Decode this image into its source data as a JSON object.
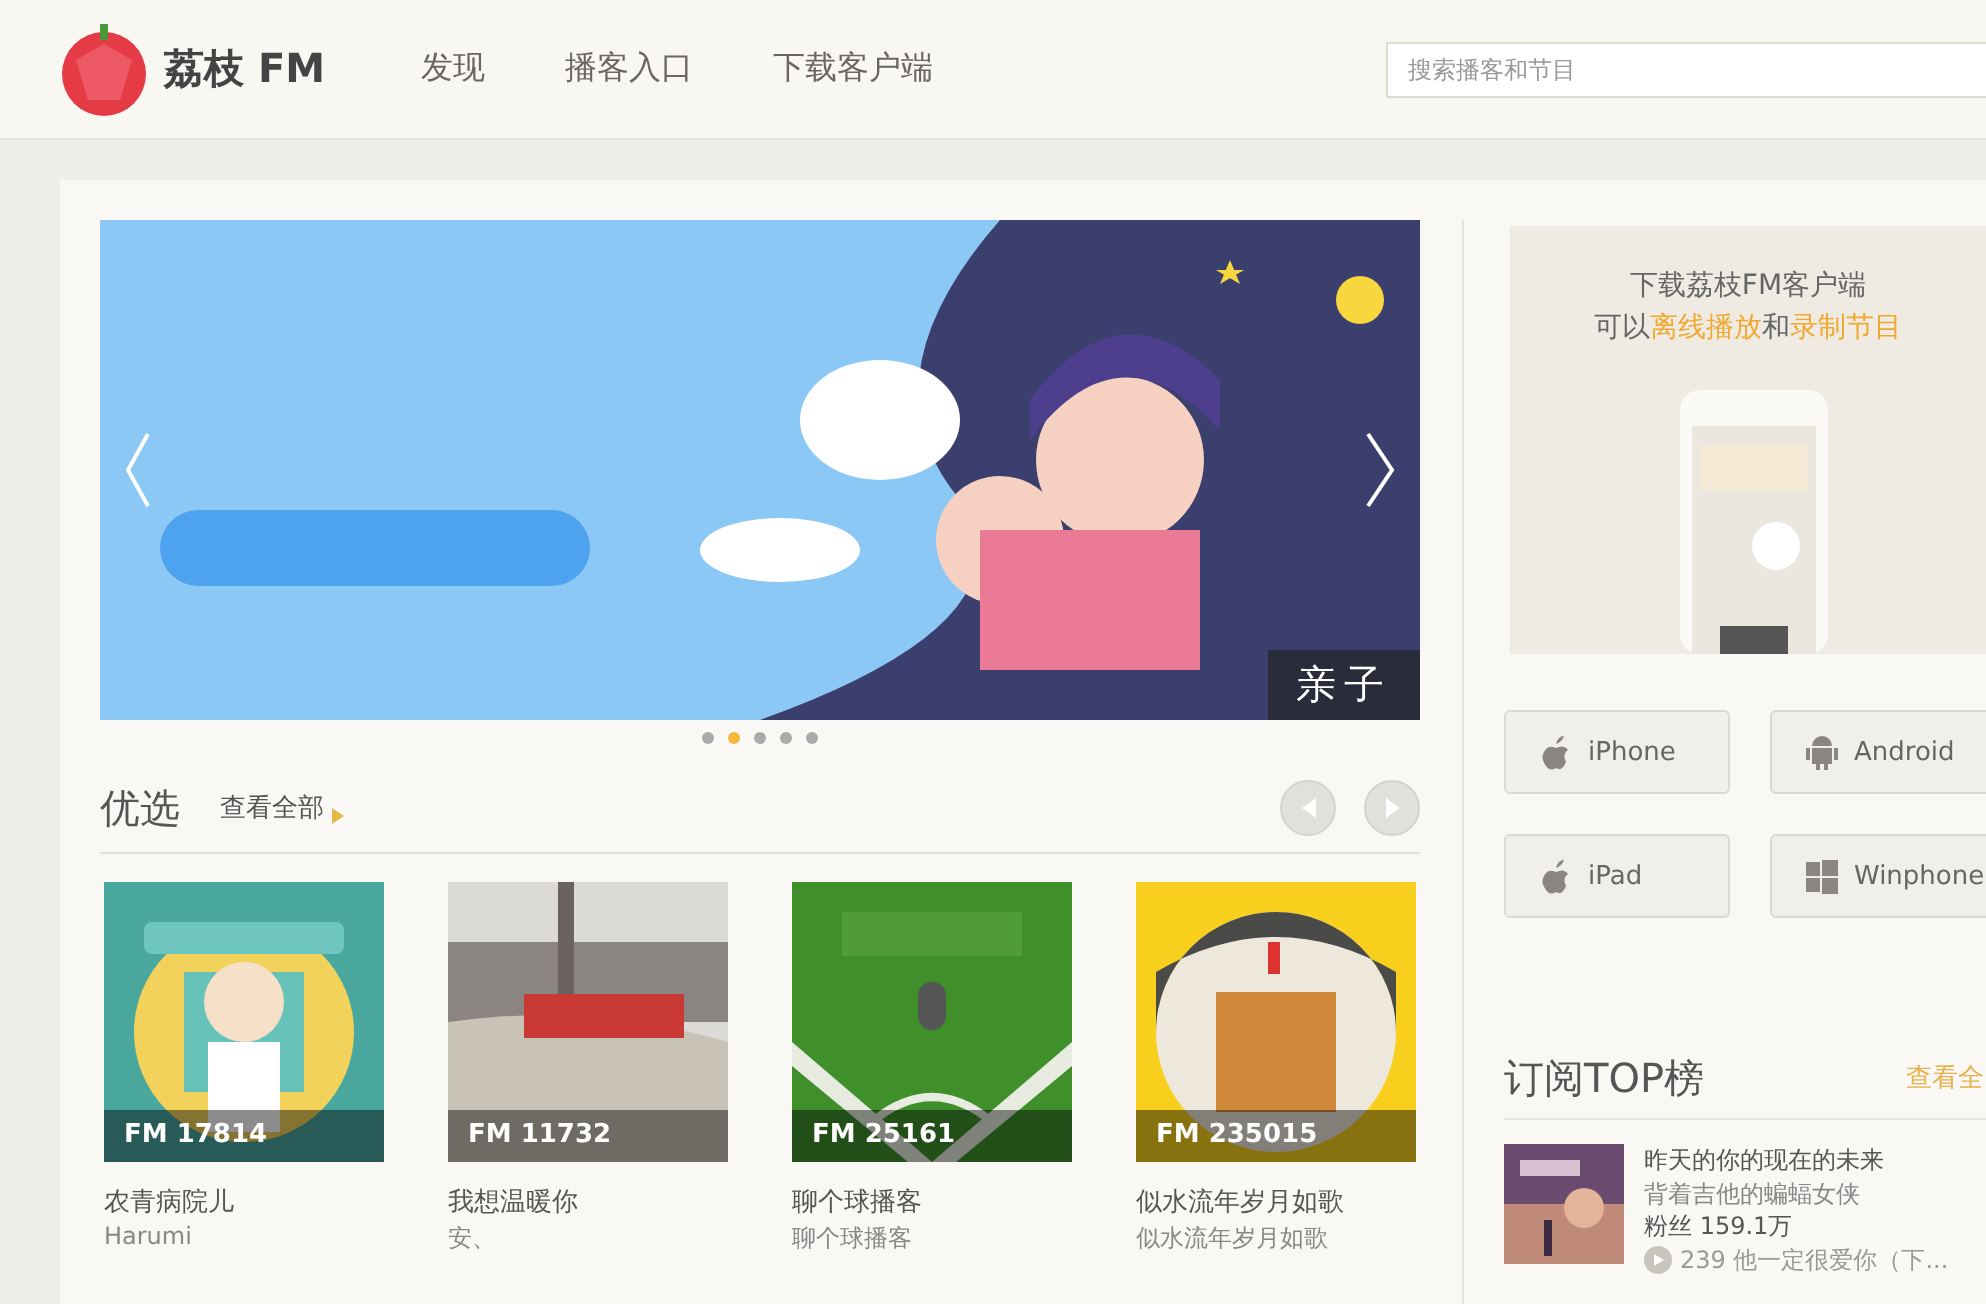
{
  "header": {
    "logo": "荔枝 FM",
    "nav": [
      {
        "label": "发现"
      },
      {
        "label": "播客入口"
      },
      {
        "label": "下载客户端"
      }
    ],
    "search": {
      "placeholder": "搜索播客和节目"
    }
  },
  "banner": {
    "kind": "picture",
    "tag": "亲子",
    "dots": [
      {
        "selected": false
      },
      {
        "selected": true
      },
      {
        "selected": false
      },
      {
        "selected": false
      },
      {
        "selected": false
      }
    ]
  },
  "featured": {
    "title": "优选",
    "more": "查看全部",
    "items": [
      {
        "fm": "FM 17814",
        "title": "农青病院儿",
        "subtitle": "Harumi"
      },
      {
        "fm": "FM 11732",
        "title": "我想温暖你",
        "subtitle": "安、"
      },
      {
        "fm": "FM 25161",
        "title": "聊个球播客",
        "subtitle": "聊个球播客"
      },
      {
        "fm": "FM 235015",
        "title": "似水流年岁月如歌",
        "subtitle": "似水流年岁月如歌"
      }
    ]
  },
  "download": {
    "line1": "下载荔枝FM客户端",
    "line2": [
      {
        "text": "可以",
        "highlight": false
      },
      {
        "text": "离线播放",
        "highlight": true
      },
      {
        "text": "和",
        "highlight": false
      },
      {
        "text": "录制节目",
        "highlight": true
      }
    ],
    "platforms": [
      {
        "label": "iPhone",
        "kind": "apple"
      },
      {
        "label": "Android",
        "kind": "android"
      },
      {
        "label": "iPad",
        "kind": "apple"
      },
      {
        "label": "Winphone",
        "kind": "windows"
      }
    ]
  },
  "top": {
    "title": "订阅TOP榜",
    "more": "查看全",
    "items": [
      {
        "title": "昨天的你的现在的未来",
        "author": "背着吉他的蝙蝠女侠",
        "fans": "粉丝 159.1万",
        "latest": "239 他一定很爱你（下..."
      }
    ]
  }
}
